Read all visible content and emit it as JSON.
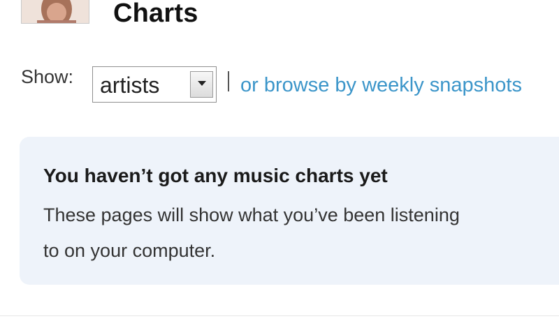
{
  "header": {
    "title": "Charts",
    "avatar_icon": "user-avatar"
  },
  "filter": {
    "show_label": "Show:",
    "selected_value": "artists",
    "dropdown_icon": "chevron-down-icon",
    "browse_link": "or browse by weekly snapshots"
  },
  "notice": {
    "heading": "You haven’t got any music charts yet",
    "body_line1": "These pages will show what you’ve been listening",
    "body_line2": "to on your computer.",
    "background": "#eef3fa"
  },
  "colors": {
    "link": "#3b95c9",
    "title": "#111111"
  }
}
